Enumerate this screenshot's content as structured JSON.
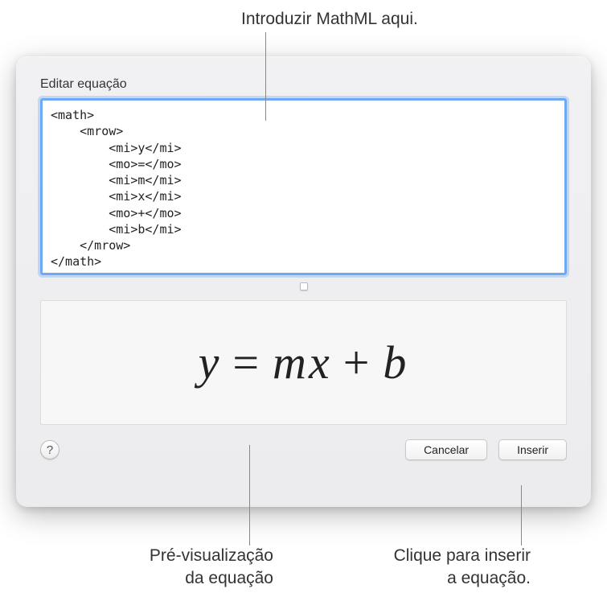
{
  "callouts": {
    "top": "Introduzir MathML aqui.",
    "bottom_left_line1": "Pré-visualização",
    "bottom_left_line2": "da equação",
    "bottom_right_line1": "Clique para inserir",
    "bottom_right_line2": "a equação."
  },
  "panel": {
    "title": "Editar equação",
    "editor_value": "<math>\n    <mrow>\n        <mi>y</mi>\n        <mo>=</mo>\n        <mi>m</mi>\n        <mi>x</mi>\n        <mo>+</mo>\n        <mi>b</mi>\n    </mrow>\n</math>"
  },
  "preview": {
    "y": "y",
    "eq": "=",
    "m": "m",
    "x": "x",
    "plus": "+",
    "b": "b"
  },
  "buttons": {
    "help": "?",
    "cancel": "Cancelar",
    "insert": "Inserir"
  }
}
